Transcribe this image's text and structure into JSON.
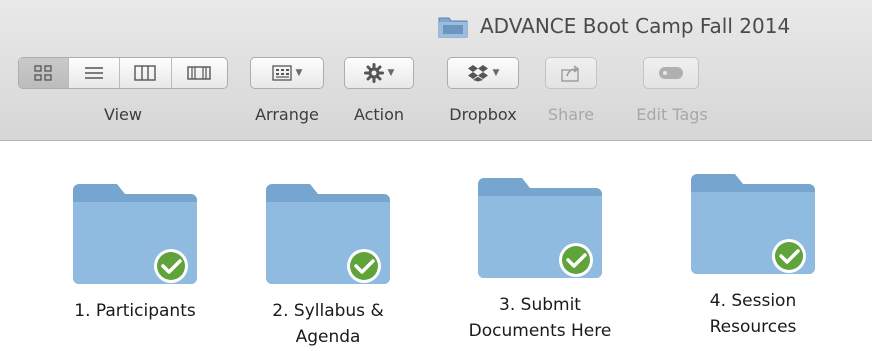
{
  "window": {
    "title": "ADVANCE Boot Camp Fall 2014",
    "icon": "folder-icon"
  },
  "toolbar": {
    "view_label": "View",
    "view_modes": [
      "icon-view",
      "list-view",
      "column-view",
      "cover-flow-view"
    ],
    "view_selected": "icon-view",
    "arrange_label": "Arrange",
    "action_label": "Action",
    "dropbox_label": "Dropbox",
    "share_label": "Share",
    "share_enabled": false,
    "edit_tags_label": "Edit Tags",
    "edit_tags_enabled": false
  },
  "items": [
    {
      "line1": "1. Participants",
      "line2": "",
      "status": "synced"
    },
    {
      "line1": "2. Syllabus &",
      "line2": "Agenda",
      "status": "synced"
    },
    {
      "line1": "3. Submit",
      "line2": "Documents Here",
      "status": "synced"
    },
    {
      "line1": "4. Session",
      "line2": "Resources",
      "status": "synced"
    }
  ],
  "colors": {
    "folder": "#8ab6d9",
    "sync_badge": "#5fa33a"
  }
}
